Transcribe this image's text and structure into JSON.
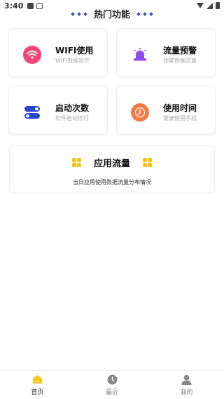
{
  "status": {
    "time": "3:40"
  },
  "section": {
    "title": "热门功能"
  },
  "cards": [
    {
      "title": "WIFI使用",
      "sub": "WIFI数据监控",
      "icon": "wifi-icon",
      "color": "#f0457a"
    },
    {
      "title": "流量预警",
      "sub": "预警数据流量",
      "icon": "alarm-icon",
      "color": "#8e4dea"
    },
    {
      "title": "启动次数",
      "sub": "软件启动排行",
      "icon": "toggle-icon",
      "color": "#2b4acb"
    },
    {
      "title": "使用时间",
      "sub": "健康使用手机",
      "icon": "clock-icon",
      "color": "#f27a46"
    }
  ],
  "traffic": {
    "title": "应用流量",
    "sub": "当日应用使用数据流量分布情况",
    "icon_color": "#f5c518"
  },
  "nav": [
    {
      "label": "首页",
      "icon": "home-icon",
      "active": true
    },
    {
      "label": "最近",
      "icon": "recent-clock-icon",
      "active": false
    },
    {
      "label": "我的",
      "icon": "profile-icon",
      "active": false
    }
  ]
}
